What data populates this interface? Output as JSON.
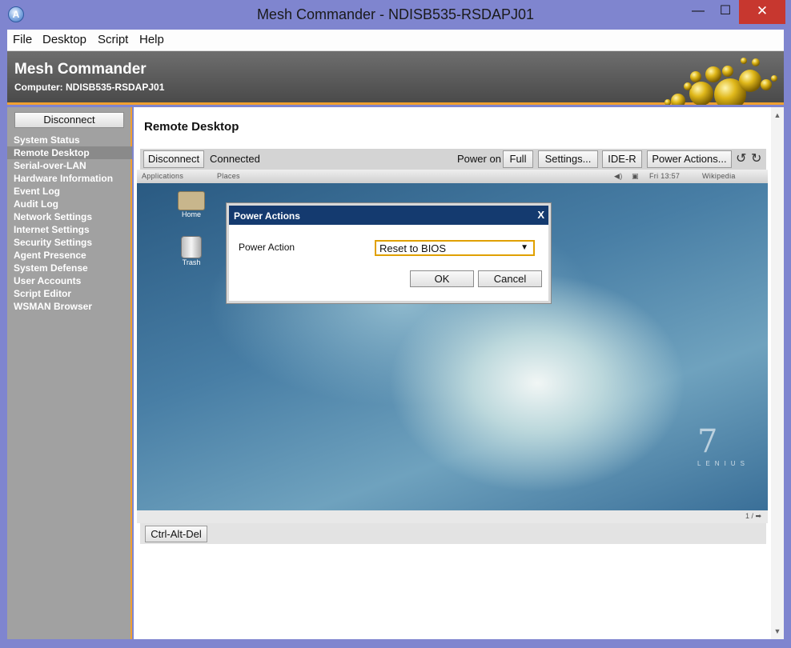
{
  "window": {
    "title": "Mesh Commander - NDISB535-RSDAPJ01",
    "icon_letter": "A",
    "minimize_glyph": "—",
    "maximize_glyph": "☐",
    "close_glyph": "✕"
  },
  "menu": [
    "File",
    "Desktop",
    "Script",
    "Help"
  ],
  "header": {
    "title": "Mesh Commander",
    "subtitle": "Computer: NDISB535-RSDAPJ01"
  },
  "sidebar": {
    "disconnect_label": "Disconnect",
    "items": [
      {
        "label": "System Status",
        "active": false
      },
      {
        "label": "Remote Desktop",
        "active": true
      },
      {
        "label": "Serial-over-LAN",
        "active": false
      },
      {
        "label": "Hardware Information",
        "active": false
      },
      {
        "label": "Event Log",
        "active": false
      },
      {
        "label": "Audit Log",
        "active": false
      },
      {
        "label": "Network Settings",
        "active": false
      },
      {
        "label": "Internet Settings",
        "active": false
      },
      {
        "label": "Security Settings",
        "active": false
      },
      {
        "label": "Agent Presence",
        "active": false
      },
      {
        "label": "System Defense",
        "active": false
      },
      {
        "label": "User Accounts",
        "active": false
      },
      {
        "label": "Script Editor",
        "active": false
      },
      {
        "label": "WSMAN Browser",
        "active": false
      }
    ]
  },
  "main": {
    "title": "Remote Desktop",
    "toolbar": {
      "disconnect": "Disconnect",
      "status": "Connected",
      "power_state": "Power on",
      "full": "Full",
      "settings": "Settings...",
      "ider": "IDE-R",
      "power_actions": "Power Actions...",
      "rotate_left_glyph": "↺",
      "rotate_right_glyph": "↻"
    },
    "remote_screen": {
      "panel": {
        "applications": "Applications",
        "places": "Places",
        "clock": "Fri 13:57",
        "browser": "Wikipedia"
      },
      "icons": [
        {
          "label": "Home"
        },
        {
          "label": "Trash"
        }
      ],
      "watermark": "7",
      "watermark_sub": "LENIUS"
    },
    "page_indicator": "1 / ➡",
    "ctrl_alt_del": "Ctrl-Alt-Del"
  },
  "dialog": {
    "title": "Power Actions",
    "close": "X",
    "label": "Power Action",
    "selected": "Reset to BIOS",
    "ok": "OK",
    "cancel": "Cancel"
  },
  "colors": {
    "accent": "#f0a030",
    "dialog_title": "#143a6f",
    "window_frame": "#7f85cf",
    "close_button": "#c7372f"
  }
}
